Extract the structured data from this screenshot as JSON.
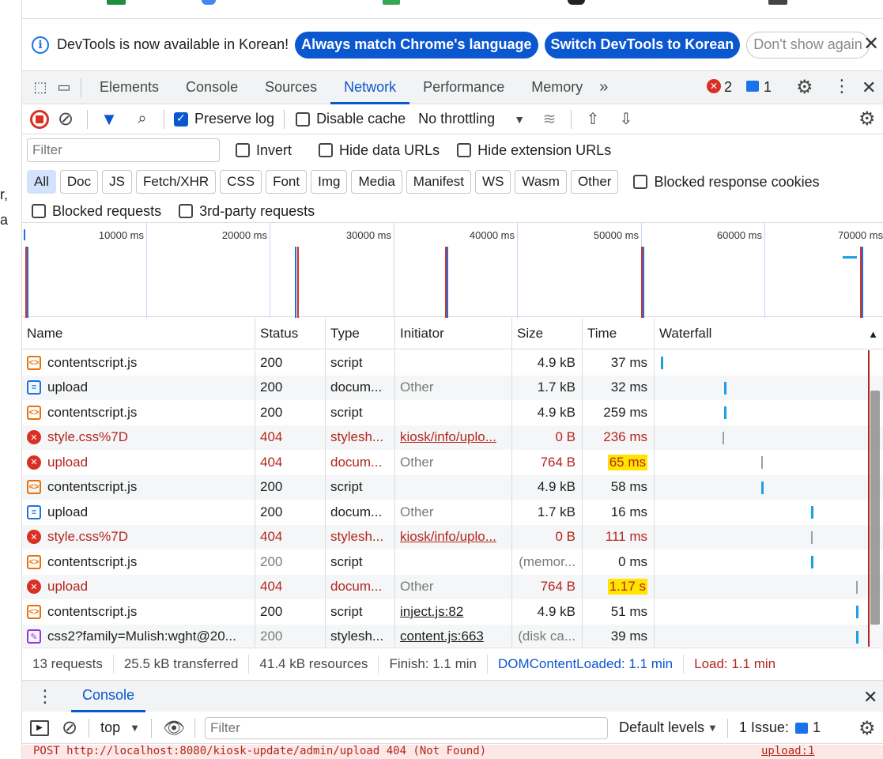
{
  "page_fragments": {
    "line1": "r,",
    "line2": "a"
  },
  "infobar": {
    "message": "DevTools is now available in Korean!",
    "btn_match": "Always match Chrome's language",
    "btn_switch": "Switch DevTools to Korean",
    "btn_dismiss": "Don't show again"
  },
  "tabs": [
    "Elements",
    "Console",
    "Sources",
    "Network",
    "Performance",
    "Memory"
  ],
  "active_tab": "Network",
  "badges": {
    "errors": "2",
    "messages": "1"
  },
  "toolbar": {
    "preserve_log": "Preserve log",
    "disable_cache": "Disable cache",
    "throttling": "No throttling"
  },
  "filter": {
    "placeholder": "Filter",
    "invert": "Invert",
    "hide_data": "Hide data URLs",
    "hide_ext": "Hide extension URLs",
    "types": [
      "All",
      "Doc",
      "JS",
      "Fetch/XHR",
      "CSS",
      "Font",
      "Img",
      "Media",
      "Manifest",
      "WS",
      "Wasm",
      "Other"
    ],
    "blocked_cookies": "Blocked response cookies",
    "blocked_requests": "Blocked requests",
    "third_party": "3rd-party requests"
  },
  "overview": {
    "ticks": [
      "10000 ms",
      "20000 ms",
      "30000 ms",
      "40000 ms",
      "50000 ms",
      "60000 ms",
      "70000 ms"
    ]
  },
  "table": {
    "headers": [
      "Name",
      "Status",
      "Type",
      "Initiator",
      "Size",
      "Time",
      "Waterfall"
    ],
    "rows": [
      {
        "icon": "script",
        "name": "contentscript.js",
        "status": "200",
        "type": "script",
        "initiator": "",
        "size": "4.9 kB",
        "time": "37 ms",
        "error": false
      },
      {
        "icon": "doc",
        "name": "upload",
        "status": "200",
        "type": "docum...",
        "initiator": "Other",
        "size": "1.7 kB",
        "time": "32 ms",
        "error": false
      },
      {
        "icon": "script",
        "name": "contentscript.js",
        "status": "200",
        "type": "script",
        "initiator": "",
        "size": "4.9 kB",
        "time": "259 ms",
        "error": false
      },
      {
        "icon": "error",
        "name": "style.css%7D",
        "status": "404",
        "type": "stylesh...",
        "initiator": "kiosk/info/uplo...",
        "size": "0 B",
        "time": "236 ms",
        "error": true
      },
      {
        "icon": "error",
        "name": "upload",
        "status": "404",
        "type": "docum...",
        "initiator": "Other",
        "size": "764 B",
        "time": "65 ms",
        "error": true,
        "highlight": true
      },
      {
        "icon": "script",
        "name": "contentscript.js",
        "status": "200",
        "type": "script",
        "initiator": "",
        "size": "4.9 kB",
        "time": "58 ms",
        "error": false
      },
      {
        "icon": "doc",
        "name": "upload",
        "status": "200",
        "type": "docum...",
        "initiator": "Other",
        "size": "1.7 kB",
        "time": "16 ms",
        "error": false
      },
      {
        "icon": "error",
        "name": "style.css%7D",
        "status": "404",
        "type": "stylesh...",
        "initiator": "kiosk/info/uplo...",
        "size": "0 B",
        "time": "111 ms",
        "error": true
      },
      {
        "icon": "script",
        "name": "contentscript.js",
        "status": "200",
        "type": "script",
        "initiator": "",
        "size": "(memor...",
        "time": "0 ms",
        "error": false,
        "graystatus": true
      },
      {
        "icon": "error",
        "name": "upload",
        "status": "404",
        "type": "docum...",
        "initiator": "Other",
        "size": "764 B",
        "time": "1.17 s",
        "error": true,
        "highlight": true
      },
      {
        "icon": "script",
        "name": "contentscript.js",
        "status": "200",
        "type": "script",
        "initiator": "inject.js:82",
        "size": "4.9 kB",
        "time": "51 ms",
        "error": false
      },
      {
        "icon": "style",
        "name": "css2?family=Mulish:wght@20...",
        "status": "200",
        "type": "stylesh...",
        "initiator": "content.js:663",
        "size": "(disk ca...",
        "time": "39 ms",
        "error": false,
        "graystatus": true
      }
    ]
  },
  "summary": {
    "requests": "13 requests",
    "transferred": "25.5 kB transferred",
    "resources": "41.4 kB resources",
    "finish": "Finish: 1.1 min",
    "dcl": "DOMContentLoaded: 1.1 min",
    "load": "Load: 1.1 min"
  },
  "drawer": {
    "tab": "Console",
    "context": "top",
    "filter_placeholder": "Filter",
    "levels": "Default levels",
    "issues_label": "1 Issue:",
    "issues_count": "1",
    "error_line": "POST http://localhost:8080/kiosk-update/admin/upload 404 (Not Found)",
    "error_source": "upload:1"
  },
  "colors": {
    "accent": "#0b57d0",
    "error": "#b3261e",
    "highlight": "#ffe500"
  }
}
